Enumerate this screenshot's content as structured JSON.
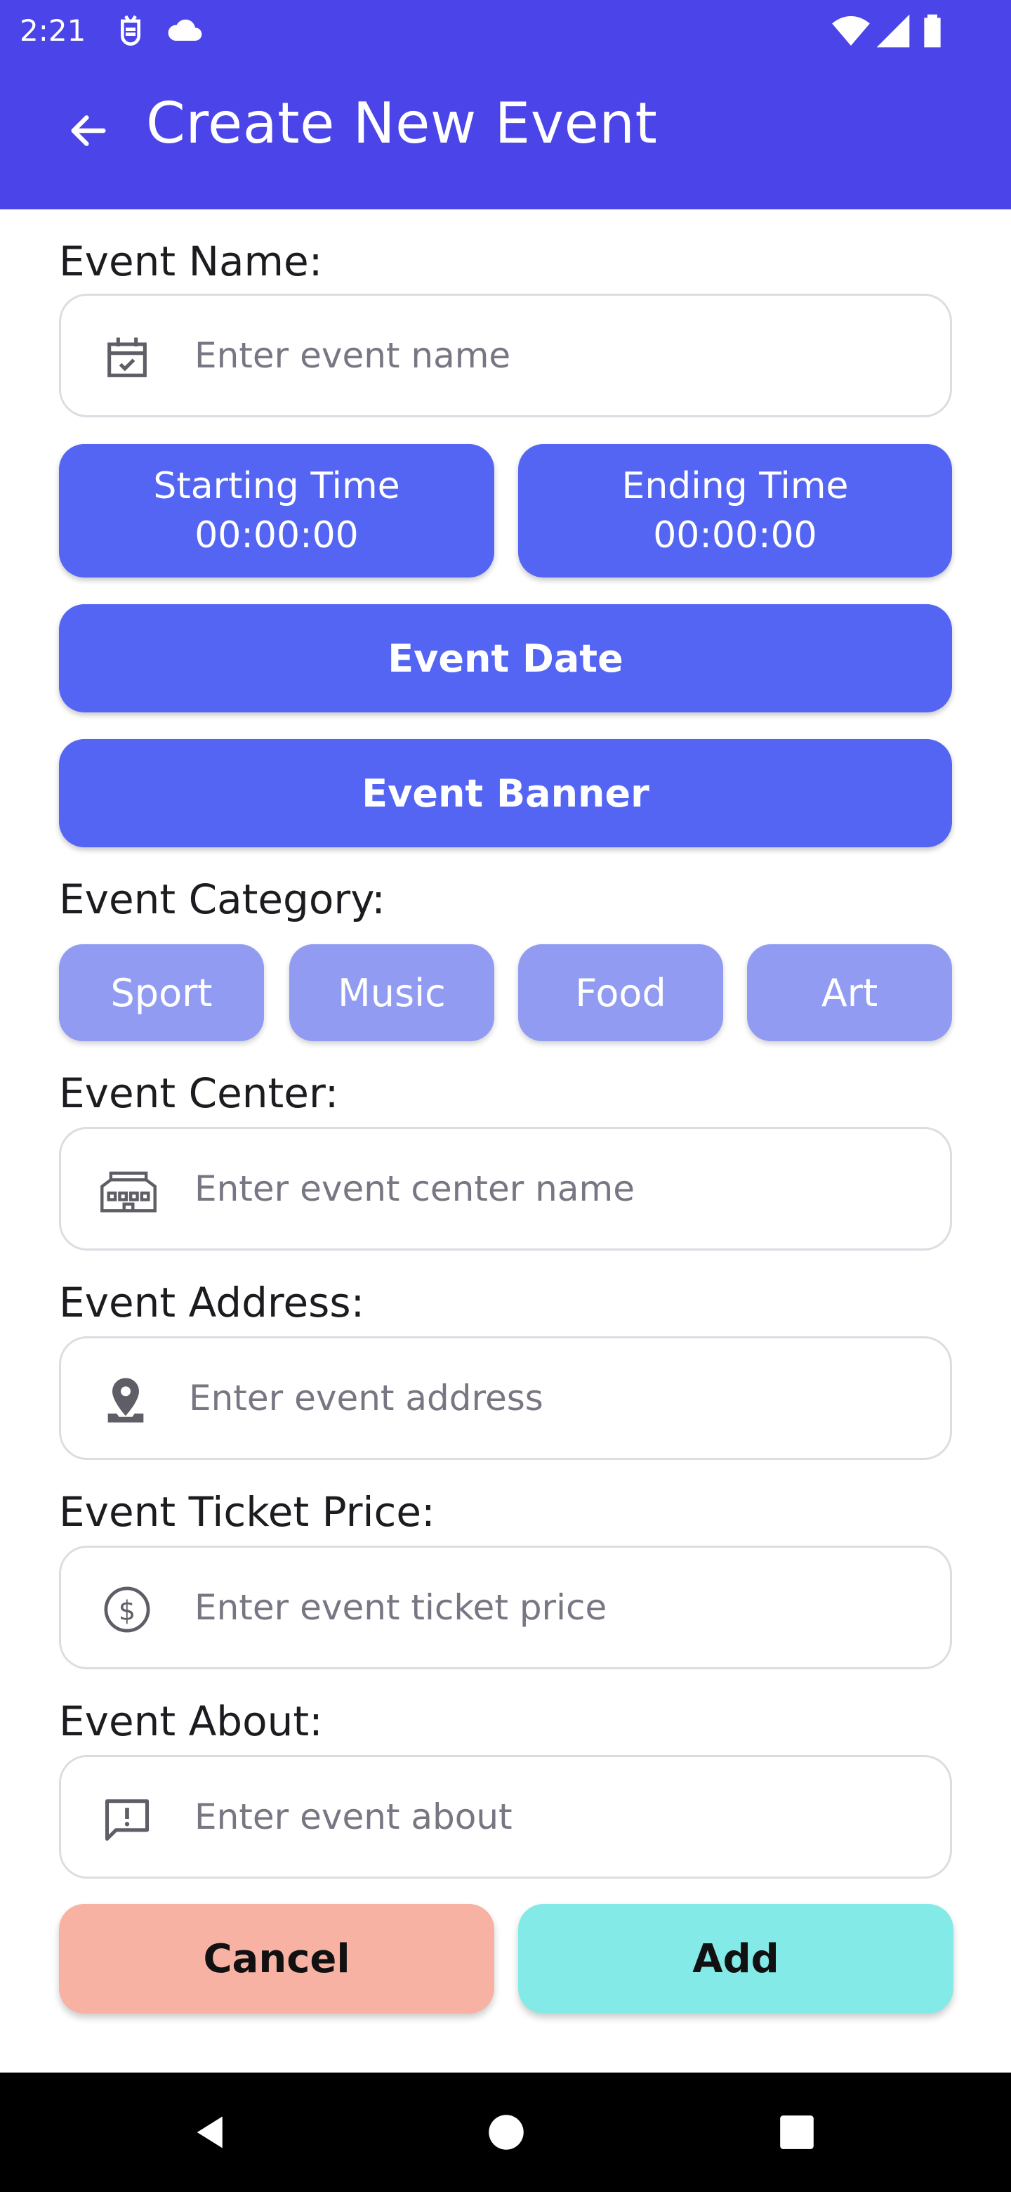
{
  "status_bar": {
    "time": "2:21",
    "left_icons": [
      "debug-icon",
      "cloud-icon"
    ],
    "right_icons": [
      "wifi-icon",
      "signal-icon",
      "battery-icon"
    ]
  },
  "app_bar": {
    "title": "Create New Event",
    "background_color": "#4a44e9",
    "back_icon": "arrow-back-icon"
  },
  "form": {
    "event_name": {
      "label": "Event Name:",
      "placeholder": "Enter event name",
      "value": "",
      "icon": "event-check-icon"
    },
    "starting_time": {
      "label": "Starting Time",
      "value": "00:00:00"
    },
    "ending_time": {
      "label": "Ending Time",
      "value": "00:00:00"
    },
    "event_date_button": "Event Date",
    "event_banner_button": "Event Banner",
    "category": {
      "label": "Event Category:",
      "options": [
        "Sport",
        "Music",
        "Food",
        "Art"
      ]
    },
    "event_center": {
      "label": "Event Center:",
      "placeholder": "Enter event center name",
      "value": "",
      "icon": "building-icon"
    },
    "event_address": {
      "label": "Event Address:",
      "placeholder": "Enter event address",
      "value": "",
      "icon": "location-pin-icon"
    },
    "ticket_price": {
      "label": "Event Ticket Price:",
      "placeholder": "Enter event ticket price",
      "value": "",
      "icon": "dollar-icon"
    },
    "event_about": {
      "label": "Event About:",
      "placeholder": "Enter event about",
      "value": "",
      "icon": "feedback-icon"
    }
  },
  "actions": {
    "cancel": "Cancel",
    "add": "Add"
  },
  "colors": {
    "primary_button": "#5465f3",
    "chip": "#919bf2",
    "cancel": "#f7b2a3",
    "add": "#84eae8"
  },
  "nav_bar": {
    "buttons": [
      "back-triangle-icon",
      "home-circle-icon",
      "recents-square-icon"
    ]
  }
}
